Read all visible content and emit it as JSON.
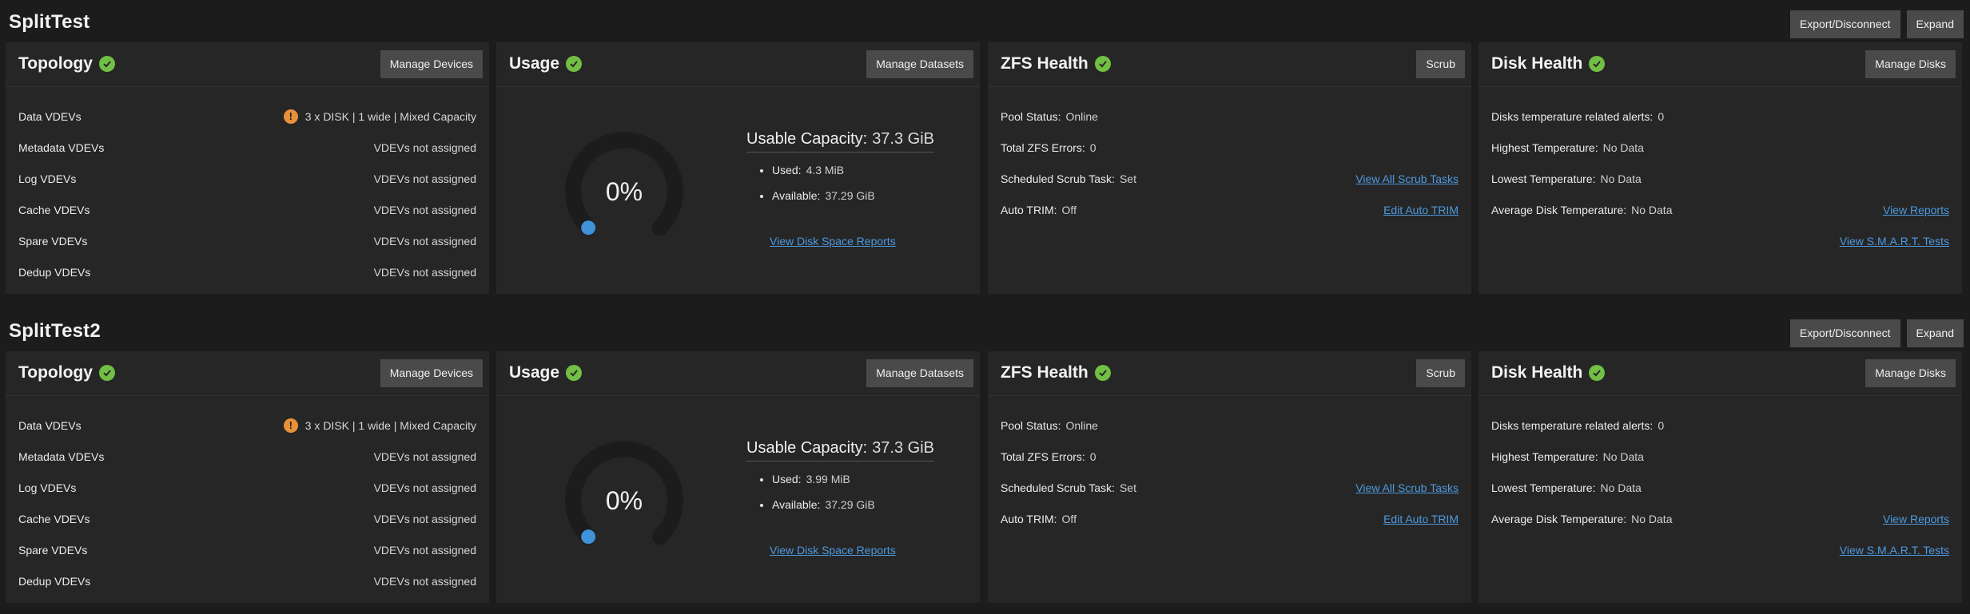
{
  "pools": [
    {
      "name": "SplitTest",
      "actions": {
        "export": "Export/Disconnect",
        "expand": "Expand"
      },
      "topology": {
        "title": "Topology",
        "button": "Manage Devices",
        "rows": [
          {
            "label": "Data VDEVs",
            "value": "3 x DISK | 1 wide | Mixed Capacity",
            "warning": true
          },
          {
            "label": "Metadata VDEVs",
            "value": "VDEVs not assigned"
          },
          {
            "label": "Log VDEVs",
            "value": "VDEVs not assigned"
          },
          {
            "label": "Cache VDEVs",
            "value": "VDEVs not assigned"
          },
          {
            "label": "Spare VDEVs",
            "value": "VDEVs not assigned"
          },
          {
            "label": "Dedup VDEVs",
            "value": "VDEVs not assigned"
          }
        ]
      },
      "usage": {
        "title": "Usage",
        "button": "Manage Datasets",
        "percent": "0%",
        "usable_label": "Usable Capacity:",
        "usable_value": "37.3 GiB",
        "used_label": "Used:",
        "used_value": "4.3 MiB",
        "available_label": "Available:",
        "available_value": "37.29 GiB",
        "link": "View Disk Space Reports"
      },
      "zfs": {
        "title": "ZFS Health",
        "button": "Scrub",
        "pool_status_label": "Pool Status:",
        "pool_status": "Online",
        "errors_label": "Total ZFS Errors:",
        "errors": "0",
        "scrub_label": "Scheduled Scrub Task:",
        "scrub": "Set",
        "scrub_link": "View All Scrub Tasks",
        "trim_label": "Auto TRIM:",
        "trim": "Off",
        "trim_link": "Edit Auto TRIM"
      },
      "disk": {
        "title": "Disk Health",
        "button": "Manage Disks",
        "alerts_label": "Disks temperature related alerts:",
        "alerts": "0",
        "highest_label": "Highest Temperature:",
        "highest": "No Data",
        "lowest_label": "Lowest Temperature:",
        "lowest": "No Data",
        "average_label": "Average Disk Temperature:",
        "average": "No Data",
        "reports_link": "View Reports",
        "smart_link": "View S.M.A.R.T. Tests"
      }
    },
    {
      "name": "SplitTest2",
      "actions": {
        "export": "Export/Disconnect",
        "expand": "Expand"
      },
      "topology": {
        "title": "Topology",
        "button": "Manage Devices",
        "rows": [
          {
            "label": "Data VDEVs",
            "value": "3 x DISK | 1 wide | Mixed Capacity",
            "warning": true
          },
          {
            "label": "Metadata VDEVs",
            "value": "VDEVs not assigned"
          },
          {
            "label": "Log VDEVs",
            "value": "VDEVs not assigned"
          },
          {
            "label": "Cache VDEVs",
            "value": "VDEVs not assigned"
          },
          {
            "label": "Spare VDEVs",
            "value": "VDEVs not assigned"
          },
          {
            "label": "Dedup VDEVs",
            "value": "VDEVs not assigned"
          }
        ]
      },
      "usage": {
        "title": "Usage",
        "button": "Manage Datasets",
        "percent": "0%",
        "usable_label": "Usable Capacity:",
        "usable_value": "37.3 GiB",
        "used_label": "Used:",
        "used_value": "3.99 MiB",
        "available_label": "Available:",
        "available_value": "37.29 GiB",
        "link": "View Disk Space Reports"
      },
      "zfs": {
        "title": "ZFS Health",
        "button": "Scrub",
        "pool_status_label": "Pool Status:",
        "pool_status": "Online",
        "errors_label": "Total ZFS Errors:",
        "errors": "0",
        "scrub_label": "Scheduled Scrub Task:",
        "scrub": "Set",
        "scrub_link": "View All Scrub Tasks",
        "trim_label": "Auto TRIM:",
        "trim": "Off",
        "trim_link": "Edit Auto TRIM"
      },
      "disk": {
        "title": "Disk Health",
        "button": "Manage Disks",
        "alerts_label": "Disks temperature related alerts:",
        "alerts": "0",
        "highest_label": "Highest Temperature:",
        "highest": "No Data",
        "lowest_label": "Lowest Temperature:",
        "lowest": "No Data",
        "average_label": "Average Disk Temperature:",
        "average": "No Data",
        "reports_link": "View Reports",
        "smart_link": "View S.M.A.R.T. Tests"
      }
    }
  ],
  "colors": {
    "ok": "#71bf44",
    "warning": "#e8903a",
    "link": "#4d9ae0",
    "gauge_track": "#1c1c1c",
    "gauge_dot": "#3f91d8"
  },
  "icons": {
    "status_ok": "check-circle-icon",
    "warning": "exclamation-circle-icon"
  }
}
